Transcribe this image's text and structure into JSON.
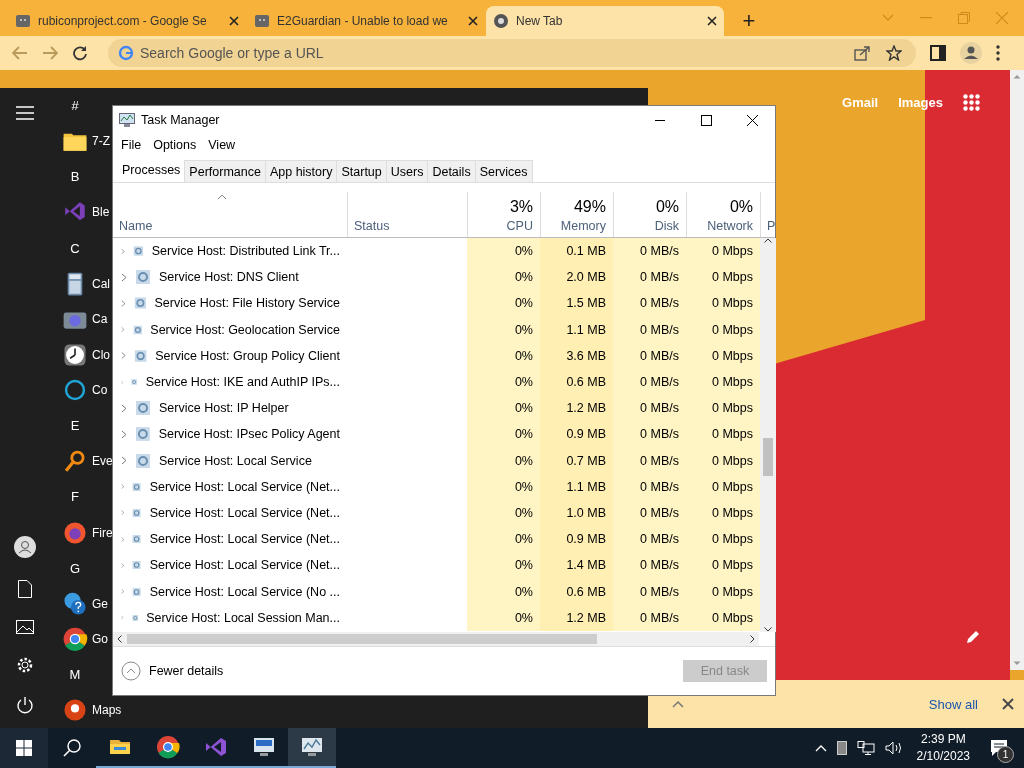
{
  "browser": {
    "tabs": [
      {
        "title": "rubiconproject.com - Google Se",
        "selected": false
      },
      {
        "title": "E2Guardian - Unable to load we",
        "selected": false
      },
      {
        "title": "New Tab",
        "selected": true
      }
    ],
    "new_tab_button": "+",
    "address_bar": {
      "placeholder": "Search Google or type a URL"
    },
    "page_links": [
      "Gmail",
      "Images"
    ],
    "downloads_bar": {
      "show_all": "Show all"
    }
  },
  "start_menu": {
    "groups": [
      {
        "letter": "#",
        "apps": [
          {
            "name": "7-Z",
            "kind": "folder"
          }
        ]
      },
      {
        "letter": "B",
        "apps": [
          {
            "name": "Ble",
            "kind": "studio"
          }
        ]
      },
      {
        "letter": "C",
        "apps": [
          {
            "name": "Cal",
            "kind": "calculator"
          },
          {
            "name": "Ca",
            "kind": "camera"
          },
          {
            "name": "Clo",
            "kind": "clock"
          },
          {
            "name": "Co",
            "kind": "ring"
          }
        ]
      },
      {
        "letter": "E",
        "apps": [
          {
            "name": "Eve",
            "kind": "magnifier"
          }
        ]
      },
      {
        "letter": "F",
        "apps": [
          {
            "name": "Fire",
            "kind": "firefox"
          }
        ]
      },
      {
        "letter": "G",
        "apps": [
          {
            "name": "Ge",
            "kind": "help"
          },
          {
            "name": "Go",
            "kind": "chrome"
          }
        ]
      },
      {
        "letter": "M",
        "apps": [
          {
            "name": "Maps",
            "kind": "pin"
          }
        ]
      }
    ]
  },
  "task_manager": {
    "title": "Task Manager",
    "menu": [
      "File",
      "Options",
      "View"
    ],
    "tabs": [
      {
        "label": "Processes",
        "selected": true
      },
      {
        "label": "Performance",
        "selected": false
      },
      {
        "label": "App history",
        "selected": false
      },
      {
        "label": "Startup",
        "selected": false
      },
      {
        "label": "Users",
        "selected": false
      },
      {
        "label": "Details",
        "selected": false
      },
      {
        "label": "Services",
        "selected": false
      }
    ],
    "columns": [
      {
        "label": "Name",
        "sorted": true
      },
      {
        "label": "Status",
        "sorted": false
      },
      {
        "summary": "3%",
        "label": "CPU",
        "sorted": false
      },
      {
        "summary": "49%",
        "label": "Memory",
        "sorted": false
      },
      {
        "summary": "0%",
        "label": "Disk",
        "sorted": false
      },
      {
        "summary": "0%",
        "label": "Network",
        "sorted": false
      },
      {
        "label": "P",
        "sorted": false
      }
    ],
    "rows": [
      {
        "name": "Service Host: Distributed Link Tr...",
        "cpu": "0%",
        "memory": "0.1 MB",
        "disk": "0 MB/s",
        "network": "0 Mbps"
      },
      {
        "name": "Service Host: DNS Client",
        "cpu": "0%",
        "memory": "2.0 MB",
        "disk": "0 MB/s",
        "network": "0 Mbps"
      },
      {
        "name": "Service Host: File History Service",
        "cpu": "0%",
        "memory": "1.5 MB",
        "disk": "0 MB/s",
        "network": "0 Mbps"
      },
      {
        "name": "Service Host: Geolocation Service",
        "cpu": "0%",
        "memory": "1.1 MB",
        "disk": "0 MB/s",
        "network": "0 Mbps"
      },
      {
        "name": "Service Host: Group Policy Client",
        "cpu": "0%",
        "memory": "3.6 MB",
        "disk": "0 MB/s",
        "network": "0 Mbps"
      },
      {
        "name": "Service Host: IKE and AuthIP IPs...",
        "cpu": "0%",
        "memory": "0.6 MB",
        "disk": "0 MB/s",
        "network": "0 Mbps"
      },
      {
        "name": "Service Host: IP Helper",
        "cpu": "0%",
        "memory": "1.2 MB",
        "disk": "0 MB/s",
        "network": "0 Mbps"
      },
      {
        "name": "Service Host: IPsec Policy Agent",
        "cpu": "0%",
        "memory": "0.9 MB",
        "disk": "0 MB/s",
        "network": "0 Mbps"
      },
      {
        "name": "Service Host: Local Service",
        "cpu": "0%",
        "memory": "0.7 MB",
        "disk": "0 MB/s",
        "network": "0 Mbps"
      },
      {
        "name": "Service Host: Local Service (Net...",
        "cpu": "0%",
        "memory": "1.1 MB",
        "disk": "0 MB/s",
        "network": "0 Mbps"
      },
      {
        "name": "Service Host: Local Service (Net...",
        "cpu": "0%",
        "memory": "1.0 MB",
        "disk": "0 MB/s",
        "network": "0 Mbps"
      },
      {
        "name": "Service Host: Local Service (Net...",
        "cpu": "0%",
        "memory": "0.9 MB",
        "disk": "0 MB/s",
        "network": "0 Mbps"
      },
      {
        "name": "Service Host: Local Service (Net...",
        "cpu": "0%",
        "memory": "1.4 MB",
        "disk": "0 MB/s",
        "network": "0 Mbps"
      },
      {
        "name": "Service Host: Local Service (No ...",
        "cpu": "0%",
        "memory": "0.6 MB",
        "disk": "0 MB/s",
        "network": "0 Mbps"
      },
      {
        "name": "Service Host: Local Session Man...",
        "cpu": "0%",
        "memory": "1.2 MB",
        "disk": "0 MB/s",
        "network": "0 Mbps"
      }
    ],
    "fewer_details": "Fewer details",
    "end_task": {
      "label": "End task",
      "disabled": true
    }
  },
  "taskbar": {
    "apps": [
      {
        "kind": "explorer",
        "active": false
      },
      {
        "kind": "chrome",
        "active": false
      },
      {
        "kind": "studio",
        "active": false
      },
      {
        "kind": "remote",
        "active": false
      },
      {
        "kind": "monitor",
        "active": true
      }
    ],
    "time": "2:39 PM",
    "date": "2/10/2023",
    "notifications": "1"
  }
}
